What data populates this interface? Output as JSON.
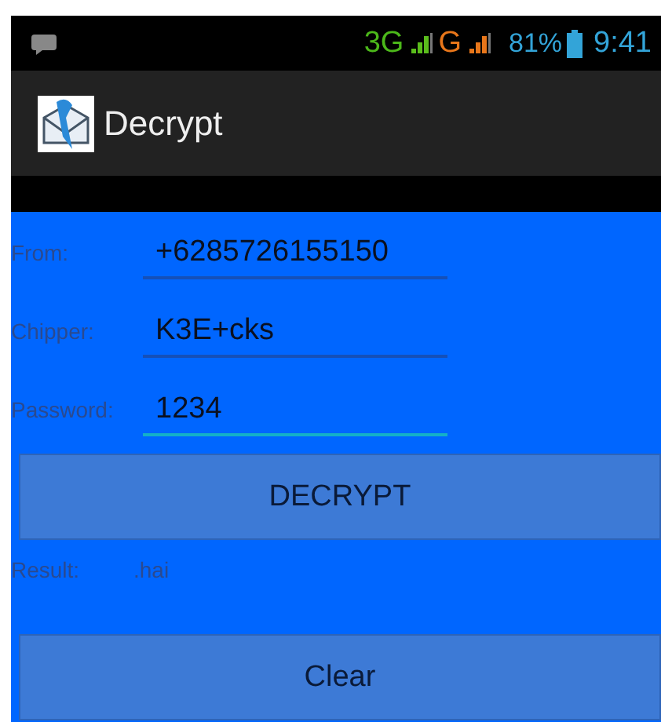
{
  "status_bar": {
    "network_1": "3G",
    "network_2": "G",
    "battery": "81%",
    "time": "9:41"
  },
  "action_bar": {
    "title": "Decrypt"
  },
  "fields": [
    {
      "label": "From:",
      "value": "+6285726155150",
      "focused": false
    },
    {
      "label": "Chipper:",
      "value": "K3E+cks",
      "focused": false
    },
    {
      "label": "Password:",
      "value": "1234",
      "focused": true
    }
  ],
  "decrypt_button": "DECRYPT",
  "result": {
    "label": "Result:",
    "value": ".hai"
  },
  "clear_button": "Clear"
}
